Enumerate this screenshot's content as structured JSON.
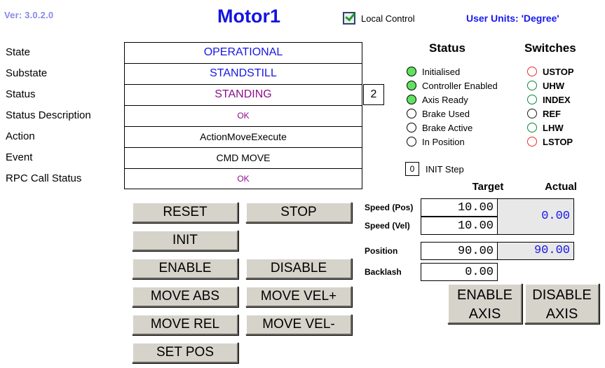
{
  "header": {
    "version": "Ver: 3.0.2.0",
    "title": "Motor1",
    "local_control_label": "Local Control",
    "local_control_checked": true,
    "user_units": "User Units: 'Degree'"
  },
  "state_table": {
    "rows": [
      {
        "label": "State",
        "value": "OPERATIONAL"
      },
      {
        "label": "Substate",
        "value": "STANDSTILL"
      },
      {
        "label": "Status",
        "value": "STANDING"
      },
      {
        "label": "Status Description",
        "value": "OK"
      },
      {
        "label": "Action",
        "value": "ActionMoveExecute"
      },
      {
        "label": "Event",
        "value": "CMD MOVE"
      },
      {
        "label": "RPC Call Status",
        "value": "OK"
      }
    ],
    "status_code": "2"
  },
  "commands": {
    "reset": "RESET",
    "stop": "STOP",
    "init": "INIT",
    "enable": "ENABLE",
    "disable": "DISABLE",
    "move_abs": "MOVE ABS",
    "move_vel_plus": "MOVE VEL+",
    "move_rel": "MOVE REL",
    "move_vel_minus": "MOVE VEL-",
    "set_pos": "SET POS"
  },
  "status_panel": {
    "heading": "Status",
    "leds": [
      {
        "label": "Initialised",
        "on": true
      },
      {
        "label": "Controller Enabled",
        "on": true
      },
      {
        "label": "Axis Ready",
        "on": true
      },
      {
        "label": "Brake Used",
        "on": false
      },
      {
        "label": "Brake Active",
        "on": false
      },
      {
        "label": "In Position",
        "on": false
      }
    ],
    "init_step_value": "0",
    "init_step_label": "INIT Step"
  },
  "switches_panel": {
    "heading": "Switches",
    "leds": [
      {
        "label": "USTOP",
        "color": "red"
      },
      {
        "label": "UHW",
        "color": "green"
      },
      {
        "label": "INDEX",
        "color": "green"
      },
      {
        "label": "REF",
        "color": "dark"
      },
      {
        "label": "LHW",
        "color": "green"
      },
      {
        "label": "LSTOP",
        "color": "red"
      }
    ]
  },
  "target_actual": {
    "target_heading": "Target",
    "actual_heading": "Actual",
    "speed_pos_label": "Speed (Pos)",
    "speed_vel_label": "Speed (Vel)",
    "position_label": "Position",
    "backlash_label": "Backlash",
    "speed_pos_target": "10.00",
    "speed_vel_target": "10.00",
    "speed_actual": "0.00",
    "position_target": "90.00",
    "position_actual": "90.00",
    "backlash_target": "0.00",
    "enable_axis_line1": "ENABLE",
    "enable_axis_line2": "AXIS",
    "disable_axis_line1": "DISABLE",
    "disable_axis_line2": "AXIS"
  },
  "colors": {
    "title_blue": "#1414e0",
    "value_blue": "#1717e4",
    "value_purple": "#8c0e8c",
    "led_green": "#5fe35f",
    "led_red_outline": "#ef2b2b",
    "button_face": "#d6d3cb",
    "readonly_bg": "#e8e8e8"
  }
}
